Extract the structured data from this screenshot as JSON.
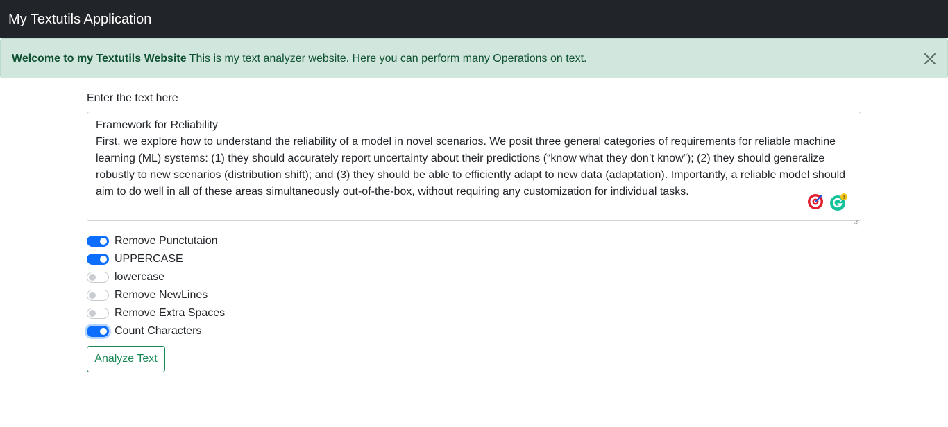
{
  "navbar": {
    "brand": "My Textutils Application"
  },
  "alert": {
    "strong": "Welcome to my Textutils Website",
    "message": " This is my text analyzer website. Here you can perform many Operations on text.",
    "close_icon": "close-icon"
  },
  "form": {
    "label": "Enter the text here",
    "text_lines": [
      "Framework for Reliability",
      "First, we explore how to understand the reliability of a model in novel scenarios. We posit three general categories of requirements for reliable machine",
      "learning (ML) systems: (1) they should accurately report uncertainty about their predictions (“know what they don’t know”); (2) they should generalize",
      "robustly to new scenarios (distribution shift); and (3) they should be able to efficiently adapt to new data (adaptation). Importantly, a reliable model should",
      "aim to do well in all of these areas simultaneously out-of-the-box, without requiring any customization for individual tasks."
    ],
    "extensions": [
      {
        "icon": "target-extension-icon"
      },
      {
        "icon": "grammarly-icon",
        "badge": "3"
      }
    ]
  },
  "switches": [
    {
      "label": "Remove Punctutaion",
      "on": true
    },
    {
      "label": "UPPERCASE",
      "on": true
    },
    {
      "label": "lowercase",
      "on": false
    },
    {
      "label": "Remove NewLines",
      "on": false
    },
    {
      "label": "Remove Extra Spaces",
      "on": false
    },
    {
      "label": "Count Characters",
      "on": true
    }
  ],
  "button": {
    "label": "Analyze Text"
  },
  "colors": {
    "navbar": "#212529",
    "alert_bg": "#d1e7dd",
    "alert_text": "#0f5132",
    "switch_on": "#0d6efd",
    "button": "#198754",
    "grammarly": "#15c39a",
    "target_red": "#e11d2e"
  }
}
